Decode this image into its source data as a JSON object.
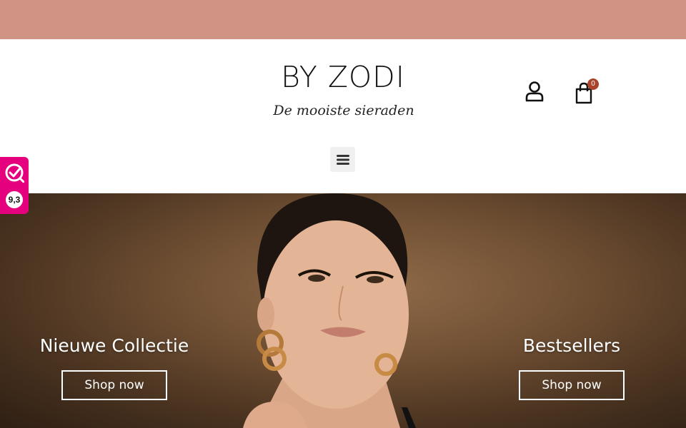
{
  "brand": {
    "logo_text": "BY ZODI",
    "tagline": "De mooiste sieraden"
  },
  "header": {
    "cart_count": "0",
    "icons": [
      "user-icon",
      "shopping-bag-icon",
      "hamburger-menu-icon"
    ]
  },
  "rating_widget": {
    "score": "9,3",
    "icon": "check-badge-icon"
  },
  "hero": {
    "left_promo": {
      "title": "Nieuwe Collectie",
      "button": "Shop now"
    },
    "right_promo": {
      "title": "Bestsellers",
      "button": "Shop now"
    }
  },
  "colors": {
    "topbar": "#cf9484",
    "badge": "#a9442a",
    "rating": "#e5007e"
  }
}
